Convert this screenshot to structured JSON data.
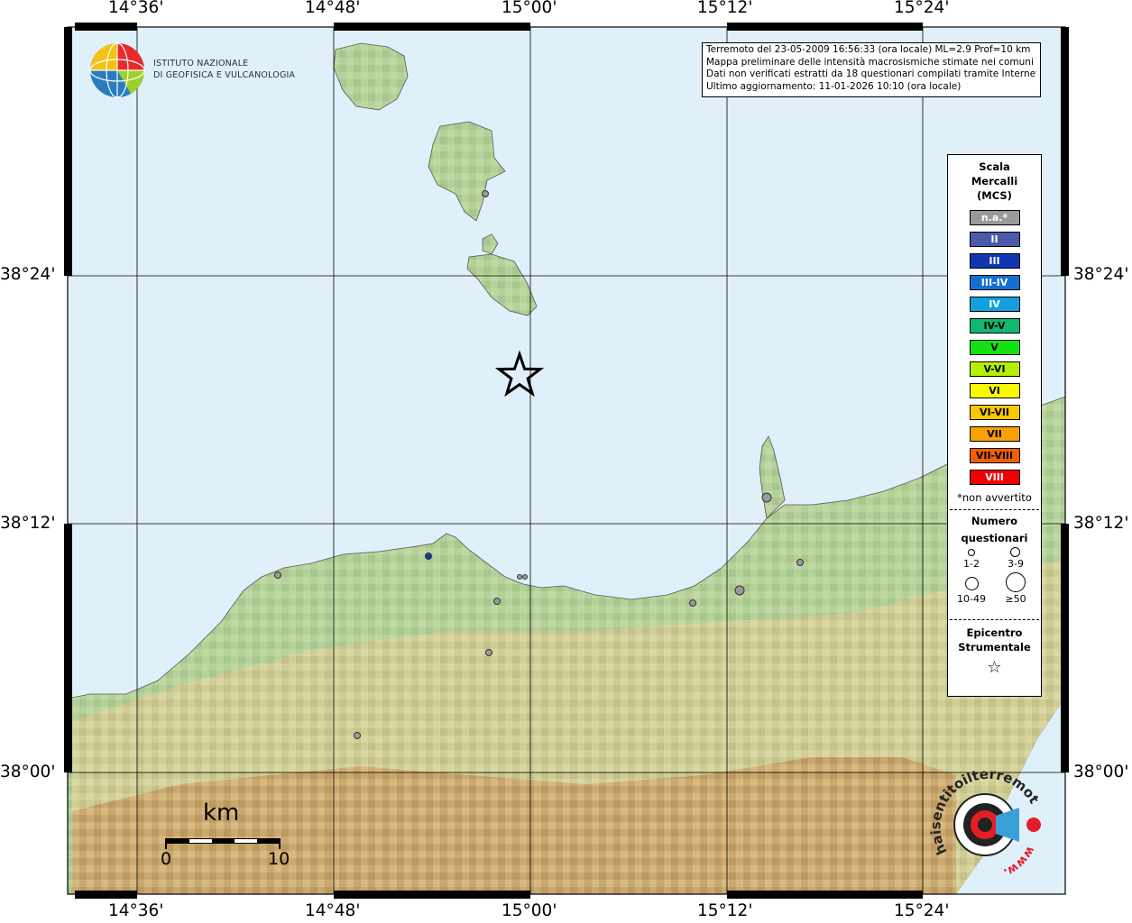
{
  "map": {
    "lon_labels": [
      "14°36'",
      "14°48'",
      "15°00'",
      "15°12'",
      "15°24'"
    ],
    "lat_labels": [
      "38°24'",
      "38°12'",
      "38°00'"
    ],
    "colors": {
      "sea": "#e0f0fa",
      "land": "#a8cc8c",
      "mountain": "#c79a5c",
      "grid": "#000000"
    }
  },
  "header": {
    "logo_line1": "ISTITUTO NAZIONALE",
    "logo_line2": "DI GEOFISICA E VULCANOLOGIA"
  },
  "info": {
    "line1": "Terremoto del 23-05-2009 16:56:33 (ora locale) ML=2.9 Prof=10 km",
    "line2": "Mappa preliminare delle intensità macrosismiche stimate nei comuni",
    "line3": "Dati non verificati estratti da 18 questionari compilati tramite Internet.",
    "line4": "Ultimo aggiornamento: 11-01-2026 10:10 (ora locale)"
  },
  "legend": {
    "title_line1": "Scala",
    "title_line2": "Mercalli",
    "title_line3": "(MCS)",
    "scale": [
      {
        "label": "n.a.*",
        "color": "#9a9a9a"
      },
      {
        "label": "II",
        "color": "#4a5aa8"
      },
      {
        "label": "III",
        "color": "#1035b0"
      },
      {
        "label": "III-IV",
        "color": "#1470d0"
      },
      {
        "label": "IV",
        "color": "#14a0e0"
      },
      {
        "label": "IV-V",
        "color": "#10b870"
      },
      {
        "label": "V",
        "color": "#14e014"
      },
      {
        "label": "V-VI",
        "color": "#b4f000"
      },
      {
        "label": "VI",
        "color": "#f8f800"
      },
      {
        "label": "VI-VII",
        "color": "#f8c800"
      },
      {
        "label": "VII",
        "color": "#f8a000"
      },
      {
        "label": "VII-VIII",
        "color": "#f06000"
      },
      {
        "label": "VIII",
        "color": "#f00000"
      }
    ],
    "note": "*non avvertito",
    "count_title1": "Numero",
    "count_title2": "questionari",
    "count_labels": [
      "1-2",
      "3-9",
      "10-49",
      "≥50"
    ],
    "epic_title1": "Epicentro",
    "epic_title2": "Strumentale",
    "star_symbol": "☆"
  },
  "scalebar": {
    "unit": "km",
    "min": "0",
    "max": "10"
  },
  "brand": {
    "text": "haisentitoilterremoto.it",
    "www": "www."
  }
}
